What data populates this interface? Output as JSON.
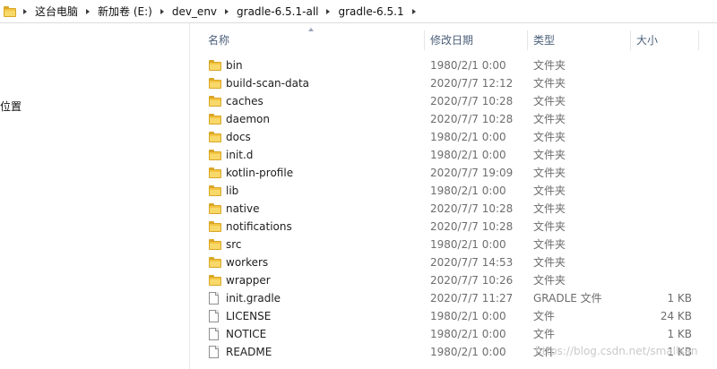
{
  "address_bar": {
    "breadcrumbs": [
      "这台电脑",
      "新加卷 (E:)",
      "dev_env",
      "gradle-6.5.1-all",
      "gradle-6.5.1"
    ]
  },
  "nav_pane": {
    "visible_item": "位置"
  },
  "columns": {
    "name": "名称",
    "modified": "修改日期",
    "type": "类型",
    "size": "大小"
  },
  "files": [
    {
      "name": "bin",
      "modified": "1980/2/1 0:00",
      "type": "文件夹",
      "size": "",
      "icon": "folder-icon"
    },
    {
      "name": "build-scan-data",
      "modified": "2020/7/7 12:12",
      "type": "文件夹",
      "size": "",
      "icon": "folder-icon"
    },
    {
      "name": "caches",
      "modified": "2020/7/7 10:28",
      "type": "文件夹",
      "size": "",
      "icon": "folder-icon"
    },
    {
      "name": "daemon",
      "modified": "2020/7/7 10:28",
      "type": "文件夹",
      "size": "",
      "icon": "folder-icon"
    },
    {
      "name": "docs",
      "modified": "1980/2/1 0:00",
      "type": "文件夹",
      "size": "",
      "icon": "folder-icon"
    },
    {
      "name": "init.d",
      "modified": "1980/2/1 0:00",
      "type": "文件夹",
      "size": "",
      "icon": "folder-icon"
    },
    {
      "name": "kotlin-profile",
      "modified": "2020/7/7 19:09",
      "type": "文件夹",
      "size": "",
      "icon": "folder-icon"
    },
    {
      "name": "lib",
      "modified": "1980/2/1 0:00",
      "type": "文件夹",
      "size": "",
      "icon": "folder-icon"
    },
    {
      "name": "native",
      "modified": "2020/7/7 10:28",
      "type": "文件夹",
      "size": "",
      "icon": "folder-icon"
    },
    {
      "name": "notifications",
      "modified": "2020/7/7 10:28",
      "type": "文件夹",
      "size": "",
      "icon": "folder-icon"
    },
    {
      "name": "src",
      "modified": "1980/2/1 0:00",
      "type": "文件夹",
      "size": "",
      "icon": "folder-icon"
    },
    {
      "name": "workers",
      "modified": "2020/7/7 14:53",
      "type": "文件夹",
      "size": "",
      "icon": "folder-icon"
    },
    {
      "name": "wrapper",
      "modified": "2020/7/7 10:26",
      "type": "文件夹",
      "size": "",
      "icon": "folder-icon"
    },
    {
      "name": "init.gradle",
      "modified": "2020/7/7 11:27",
      "type": "GRADLE 文件",
      "size": "1 KB",
      "icon": "file-icon"
    },
    {
      "name": "LICENSE",
      "modified": "1980/2/1 0:00",
      "type": "文件",
      "size": "24 KB",
      "icon": "file-icon"
    },
    {
      "name": "NOTICE",
      "modified": "1980/2/1 0:00",
      "type": "文件",
      "size": "1 KB",
      "icon": "file-icon"
    },
    {
      "name": "README",
      "modified": "1980/2/1 0:00",
      "type": "文件",
      "size": "1 KB",
      "icon": "file-icon"
    }
  ],
  "watermark": "https://blog.csdn.net/smallsan",
  "colors": {
    "header_text": "#4c607a",
    "secondary_text": "#6d6d6d",
    "folder": "#f3c543"
  }
}
